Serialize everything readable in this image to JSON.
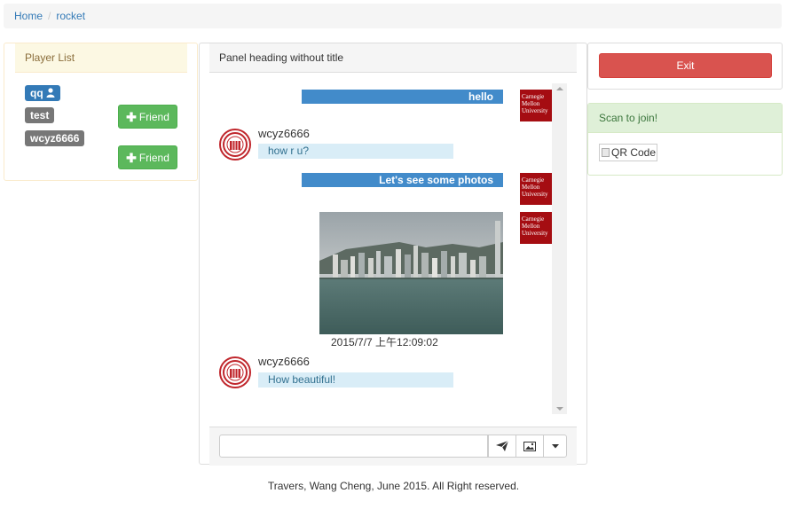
{
  "breadcrumb": {
    "home": "Home",
    "separator": "/",
    "current": "rocket"
  },
  "player_list": {
    "title": "Player List",
    "players": [
      {
        "name": "qq",
        "badge_color": "#337ab7",
        "icon": "user-icon"
      },
      {
        "name": "test",
        "badge_color": "#777777"
      },
      {
        "name": "wcyz6666",
        "badge_color": "#777777"
      }
    ],
    "friend_label": "Friend",
    "friend_icon": "plus-icon"
  },
  "chat": {
    "title": "Panel heading without title",
    "messages": [
      {
        "side": "right",
        "text": "hello",
        "avatar": "cmu-logo"
      },
      {
        "side": "left",
        "user": "wcyz6666",
        "text": "how r u?",
        "avatar": "seal-logo"
      },
      {
        "side": "right",
        "text": "Let's see some photos",
        "avatar": "cmu-logo"
      },
      {
        "side": "right",
        "type": "image",
        "caption": "2015/7/7 上午12:09:02",
        "avatar": "cmu-logo"
      },
      {
        "side": "left",
        "user": "wcyz6666",
        "text": "How beautiful!",
        "avatar": "seal-logo"
      }
    ],
    "logo_text": [
      "Carnegie",
      "Mellon",
      "University"
    ],
    "input_value": "",
    "send_icon": "send-icon",
    "image_icon": "image-icon",
    "dropdown_icon": "caret-down-icon"
  },
  "sidebar": {
    "exit_label": "Exit",
    "scan_title": "Scan to join!",
    "qr_alt": "QR Code"
  },
  "footer": {
    "text": "Travers, Wang Cheng, June 2015. All Right reserved."
  },
  "colors": {
    "primary": "#337ab7",
    "success": "#5cb85c",
    "danger": "#d9534f",
    "chat_bubble_right": "#428bca",
    "chat_bubble_left": "#d9edf7",
    "cmu_red": "#a50d12"
  }
}
